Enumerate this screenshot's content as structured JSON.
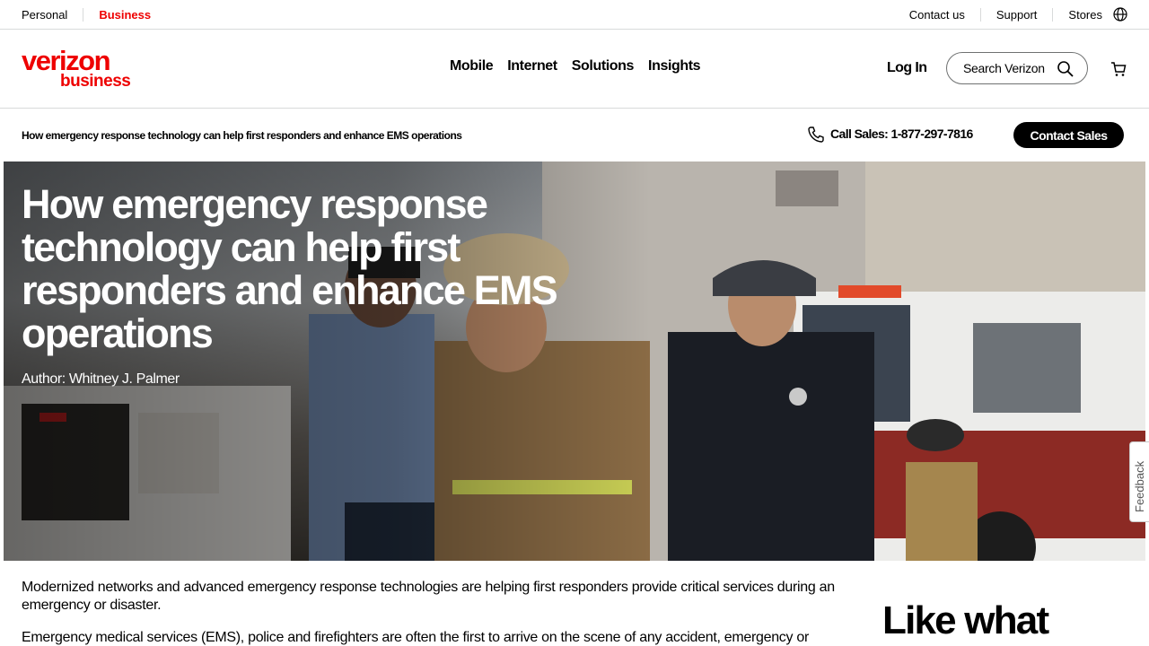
{
  "utility": {
    "personal": "Personal",
    "business": "Business",
    "contact_us": "Contact us",
    "support": "Support",
    "stores": "Stores",
    "globe_icon": "globe-icon"
  },
  "header": {
    "logo_top": "verizon",
    "logo_bottom": "business",
    "nav": [
      "Mobile",
      "Internet",
      "Solutions",
      "Insights"
    ],
    "login": "Log In",
    "search_placeholder": "Search Verizon",
    "brand_color": "#ee0000"
  },
  "subbar": {
    "breadcrumb": "How emergency response technology can help first responders and enhance EMS operations",
    "call_sales": "Call Sales: 1-877-297-7816",
    "contact_sales": "Contact Sales"
  },
  "hero": {
    "title": "How emergency response technology can help first responders and enhance EMS operations",
    "author": "Author: Whitney J. Palmer"
  },
  "feedback": "Feedback",
  "article": {
    "p1": "Modernized networks and advanced emergency response technologies are helping first responders provide critical services during an emergency or disaster.",
    "p2": "Emergency medical services (EMS), police and firefighters are often the first to arrive on the scene of any accident, emergency or"
  },
  "sidebar": {
    "heading": "Like what"
  }
}
